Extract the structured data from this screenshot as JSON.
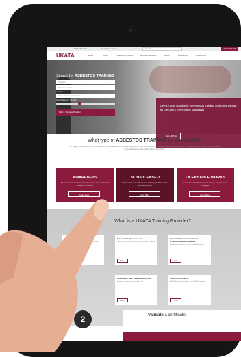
{
  "topbar": {
    "phone": "01844 654 000",
    "email": "info@ukata.org.uk",
    "search_placeholder": "Search",
    "account_label": "MY ACCOUNT"
  },
  "nav": {
    "logo": "UKATA",
    "items": [
      "Home",
      "About",
      "Training Providers",
      "Members Benefits",
      "News",
      "Resources",
      "Contact Us"
    ]
  },
  "hero": {
    "search_title_prefix": "Search for",
    "search_title_bold": "ASBESTOS TRAINING",
    "category_placeholder": "Category",
    "keywords_placeholder": "Enter Keywords",
    "location_label": "Location",
    "address_placeholder": "Enter address or postcode",
    "distance_label": "Search distance: 50 miles",
    "find_button": "Find a Training Provider",
    "box_text": "UKATA sets standards in Asbestos training and ensures that its members meet these standards",
    "box_button": "Join UKATA"
  },
  "section2": {
    "title_prefix": "What type of",
    "title_bold": "ASBESTOS TRAINING",
    "title_suffix": "do you require?",
    "paragraph": "It is a legal requirement that all who may come across asbestos in their day-to-day work have been provided with asbestos awareness training and, where appropriate, should ensure they have received the appropriate training before work starts."
  },
  "cards": [
    {
      "title": "AWARENESS",
      "text": "Asbestos awareness training for workers whose work could disturb the fabric of a building.",
      "button": "Learn More",
      "color": "#8a1b3c"
    },
    {
      "title": "NON-LICENSED",
      "text": "Non-licensable work with asbestos, including NNLW, for workers who carry out work.",
      "button": "Learn More",
      "color": "#5c1326"
    },
    {
      "title": "LICENSABLE WORKS",
      "text": "Licensable work with asbestos for workers, supervisors and managers.",
      "button": "Learn More",
      "color": "#8a1b3c"
    }
  ],
  "section3": {
    "title": "What is a UKATA Training Provider?",
    "cards": [
      {
        "title": "Course Content",
        "text": "Members are subject to audit of their course content.",
        "more": "More"
      },
      {
        "title": "Tutor Knowledge Assessed",
        "text": "Tutors are assessed to ensure their knowledge is current.",
        "more": "More"
      },
      {
        "title": "Course Management and Cost Predetermine Both Audited",
        "text": "Audits are carried out to ensure standards are met.",
        "more": "More"
      },
      {
        "title": "Continuous Tutor Development (CPD)",
        "text": "All tutors are required to complete CPD.",
        "more": "More"
      },
      {
        "title": "UKATA Certificates",
        "text": "All UKATA training providers issue UKATA certificates.",
        "more": "More"
      }
    ],
    "step": "2"
  },
  "validate": {
    "title": "Validate",
    "title_rest": "a certificate"
  },
  "colors": {
    "accent": "#8a1b3c",
    "accent_dark": "#5c1326"
  }
}
